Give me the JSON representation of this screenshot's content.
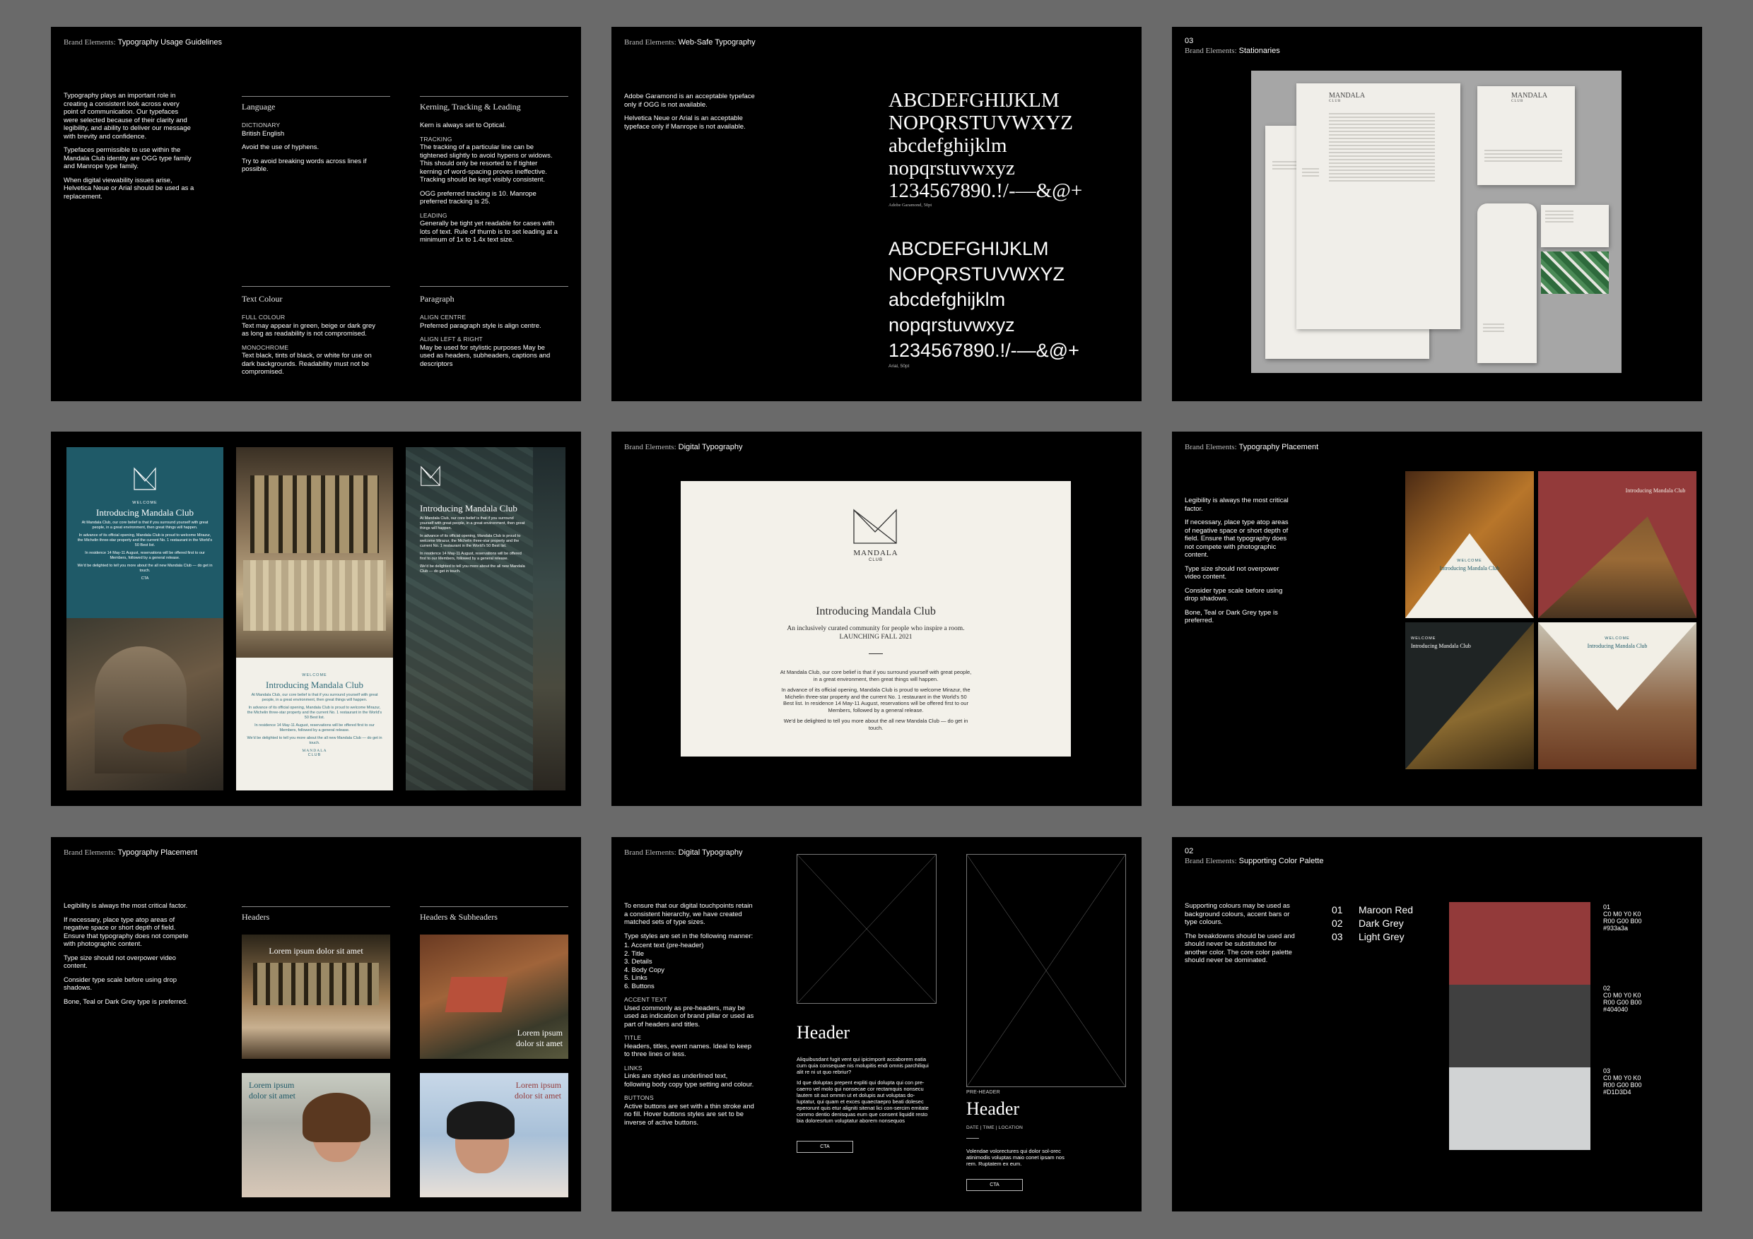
{
  "colors": {
    "maroon_red": "#933a3a",
    "dark_grey": "#404040",
    "light_grey": "#d1d3d4",
    "teal": "#1f5a68"
  },
  "panel1": {
    "pre": "Brand Elements:",
    "title": "Typography Usage Guidelines",
    "intro": [
      "Typography plays an important role in creating a consistent look across every point of communication. Our typefaces were selected because of their clarity and legibility, and ability to deliver our message with brevity and confidence.",
      "Typefaces permissible to use within the Mandala Club identity are OGG type family and Manrope type family.",
      "When digital viewability issues arise, Helvetica Neue or Arial should be used as a replacement."
    ],
    "language": {
      "heading": "Language",
      "dict_label": "DICTIONARY",
      "dict_value": "British English",
      "p1": "Avoid the use of hyphens.",
      "p2": "Try to avoid breaking words across lines if possible."
    },
    "kerning": {
      "heading": "Kerning, Tracking & Leading",
      "p1": "Kern is always set to Optical.",
      "tracking_label": "TRACKING",
      "tracking_text": "The tracking of a particular line can be tightened slightly to avoid hypens or widows. This should only be resorted to if tighter kerning of word-spacing proves ineffective. Tracking should be kept visibly consistent.",
      "pref": "OGG preferred tracking is 10. Manrope preferred tracking is 25.",
      "leading_label": "LEADING",
      "leading_text": "Generally be tight yet readable for cases with lots of text. Rule of thumb is to set leading at a minimum of 1x to 1.4x text size."
    },
    "text_colour": {
      "heading": "Text Colour",
      "full_label": "FULL COLOUR",
      "full_text": "Text may appear in green, beige or dark grey as long as readability is not compromised.",
      "mono_label": "MONOCHROME",
      "mono_text": "Text black, tints of black, or white for use on dark backgrounds. Readability must not be compromised."
    },
    "paragraph": {
      "heading": "Paragraph",
      "center_label": "ALIGN CENTRE",
      "center_text": "Preferred paragraph style is align centre.",
      "lr_label": "ALIGN LEFT & RIGHT",
      "lr_text": "May be used for stylistic purposes May be used as headers, subheaders, captions and descriptors"
    }
  },
  "panel2": {
    "pre": "Brand Elements:",
    "title": "Web-Safe Typography",
    "note1": "Adobe Garamond is an acceptable typeface only if OGG is not available.",
    "note2": "Helvetica Neue or Arial is an acceptable typeface only if Manrope is not available.",
    "serif_lines": [
      "ABCDEFGHIJKLM",
      "NOPQRSTUVWXYZ",
      "abcdefghijklm",
      "nopqrstuvwxyz",
      "1234567890.!/-—&@+"
    ],
    "serif_caption": "Adobe Garamond, 50pt",
    "sans_lines": [
      "ABCDEFGHIJKLM",
      "NOPQRSTUVWXYZ",
      "abcdefghijklm",
      "nopqrstuvwxyz",
      "1234567890.!/-—&@+"
    ],
    "sans_caption": "Arial, 50pt"
  },
  "panel3": {
    "num": "03",
    "pre": "Brand Elements:",
    "title": "Stationaries",
    "logo": "MANDALA",
    "logo_sub": "CLUB"
  },
  "panel4": {
    "welcome": "WELCOME",
    "heading": "Introducing Mandala Club",
    "body1": "At Mandala Club, our core belief is that if you surround yourself with great people, in a great environment, then great things will happen.",
    "body2": "In advance of its official opening, Mandala Club is proud to welcome Mirazur, the Michelin three-star property and the current No. 1 restaurant in the World's 50 Best list.",
    "body3": "In residence 14 May-11 August, reservations will be offered first to our Members, followed by a general release.",
    "body4": "We'd be delighted to tell you more about the all new Mandala Club — do get in touch.",
    "cta": "CTA",
    "logo": "MANDALA",
    "logo_sub": "CLUB"
  },
  "panel5": {
    "pre": "Brand Elements:",
    "title": "Digital Typography",
    "logo": "MANDALA",
    "logo_sub": "CLUB",
    "heading": "Introducing Mandala Club",
    "sub1": "An inclusively curated community for people who inspire a room.",
    "sub2": "LAUNCHING FALL 2021",
    "body1": "At Mandala Club, our core belief is that if you surround yourself with great people, in a great environment, then great things will happen.",
    "body2": "In advance of its official opening, Mandala Club is proud to welcome Mirazur, the Michelin three-star property and the current No. 1 restaurant in the World's 50 Best list. In residence 14 May-11 August, reservations will be offered first to our Members, followed by a general release.",
    "body3": "We'd be delighted to tell you more about the all new Mandala Club — do get in touch."
  },
  "panel6": {
    "pre": "Brand Elements:",
    "title": "Typography Placement",
    "p1": "Legibility is always the most critical factor.",
    "p2": "If necessary, place type atop areas of negative space or short depth of field. Ensure that typography does not compete with photographic content.",
    "p3": "Type size should not overpower video content.",
    "p4": "Consider type scale before using drop shadows.",
    "p5": "Bone, Teal or Dark Grey type is preferred.",
    "tile_heading": "Introducing Mandala Club",
    "welcome": "WELCOME"
  },
  "panel7": {
    "pre": "Brand Elements:",
    "title": "Typography Placement",
    "p1": "Legibility is always the most critical factor.",
    "p2": "If necessary, place type atop areas of negative space or short depth of field. Ensure that typography does not compete with photographic content.",
    "p3": "Type size should not overpower video content.",
    "p4": "Consider type scale before using drop shadows.",
    "p5": "Bone, Teal or Dark Grey type is preferred.",
    "col1": "Headers",
    "col2": "Headers & Subheaders",
    "img1": "Lorem ipsum dolor sit amet",
    "img2a": "Lorem ipsum",
    "img2b": "dolor sit amet",
    "img3a": "Lorem ipsum",
    "img3b": "dolor sit amet",
    "img4a": "Lorem ipsum",
    "img4b": "dolor sit amet"
  },
  "panel8": {
    "pre": "Brand Elements:",
    "title": "Digital Typography",
    "intro": "To ensure that our digital touchpoints retain a consistent hierarchy, we have created matched sets of type sizes.",
    "styles_intro": "Type styles are set in the following manner:",
    "list": [
      "1. Accent text (pre-header)",
      "2. Title",
      "3. Details",
      "4. Body Copy",
      "5. Links",
      "6. Buttons"
    ],
    "accent_label": "ACCENT TEXT",
    "accent_text": "Used commonly as pre-headers, may be used as indication of brand pillar or used as part of headers and titles.",
    "title_label": "TITLE",
    "title_text": "Headers, titles, event names. Ideal to keep to three lines or less.",
    "links_label": "LINKS",
    "links_text": "Links are styled as underlined text, following body copy type setting and colour.",
    "buttons_label": "BUTTONS",
    "buttons_text": "Active buttons are set with a thin stroke and no fill. Hover buttons styles are set to be inverse of active buttons.",
    "header": "Header",
    "body_a": "Aliquibusdant fugit vent qui ipicimporit accaborem eatia cum quia consequae nis molupitis endi omnis parchiliqui alit re ni ut quo rebriur?",
    "body_b": "Id que doluptas prepent expliti qui dolupta qui con pre-caerro vel molo qui nonsecae cor rectamquis nonsecu lautem sit aut ommin ut et dolupis aut voluptas do-luptatur, qui quam et exces quaectaepro beati dolesec eperorunt quis etur aligniti sitenat lici con-sercim emitate commo dentio denisquas eum que consent liquidit resto bia doloresrtum voluptatur aborem nonsequos",
    "cta": "CTA",
    "pre_header": "PRE-HEADER",
    "header2": "Header",
    "date_loc": "DATE | TIME | LOCATION",
    "body_c": "Volendae volorectures qui dolor sol-orec atinimodis voluptas maio conet ipsam nos rem. Ruptatem ex eum.",
    "cta2": "CTA"
  },
  "panel9": {
    "num": "02",
    "pre": "Brand Elements:",
    "title": "Supporting Color Palette",
    "p1": "Supporting colours may be used as background colours, accent bars or type colours.",
    "p2": "The breakdowns should be used and should never be substituted for another color. The core color palette should never be dominated.",
    "list": [
      {
        "num": "01",
        "name": "Maroon Red"
      },
      {
        "num": "02",
        "name": "Dark Grey"
      },
      {
        "num": "03",
        "name": "Light Grey"
      }
    ],
    "specs": [
      {
        "num": "01",
        "cmyk": "C0 M0 Y0 K0",
        "rgb": "R00 G00 B00",
        "hex": "#933a3a"
      },
      {
        "num": "02",
        "cmyk": "C0 M0 Y0 K0",
        "rgb": "R00 G00 B00",
        "hex": "#404040"
      },
      {
        "num": "03",
        "cmyk": "C0 M0 Y0 K0",
        "rgb": "R00 G00 B00",
        "hex": "#D1D3D4"
      }
    ]
  }
}
